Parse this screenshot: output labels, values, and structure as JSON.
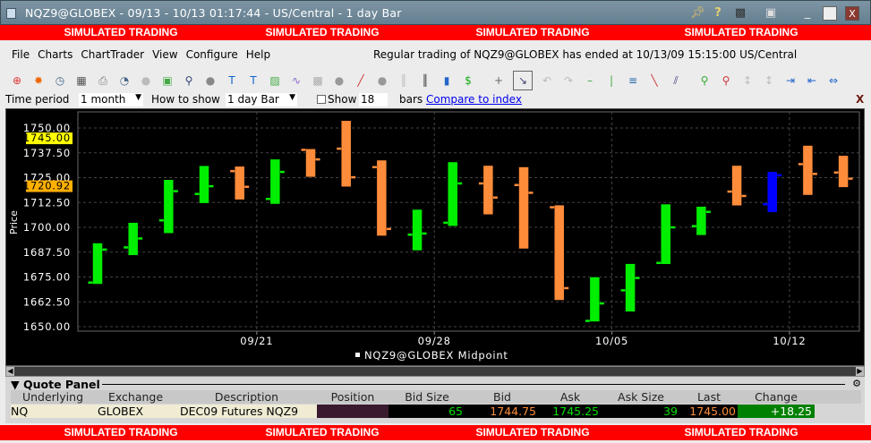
{
  "window": {
    "title": "NQZ9@GLOBEX - 09/13 - 10/13 01:17:44  - US/Central - 1 day Bar",
    "controls": [
      "pin-icon",
      "help-icon",
      "printer-icon",
      "restore-small-icon",
      "minimize-icon",
      "maximize-icon",
      "close-icon"
    ]
  },
  "banner": {
    "text": "SIMULATED TRADING",
    "color": "#ff0000"
  },
  "menu": [
    "File",
    "Charts",
    "ChartTrader",
    "View",
    "Configure",
    "Help"
  ],
  "status": "Regular trading of NQZ9@GLOBEX has ended at 10/13/09 15:15:00 US/Central",
  "toolbar": [
    "crosshair-target-icon",
    "flame-icon",
    "clock-icon",
    "grid-icon",
    "print-icon",
    "gauge-icon",
    "disabled-circle-icon",
    "layout-icon",
    "zoom-magnifier-icon",
    "stop-icon",
    "text-T-icon",
    "text-T-remove-icon",
    "chart-add-icon",
    "wave-icon",
    "grid-gray-icon",
    "circle-gray-icon",
    "pencil-icon",
    "circle-gray2-icon",
    "bars-gray-icon",
    "bars-icon",
    "volume-bars-icon",
    "dollar-icon",
    "crosshair-icon",
    "cursor-select-icon",
    "undo-icon",
    "redo-icon",
    "hline-icon",
    "vline-icon",
    "fib-icon",
    "trendline-icon",
    "channel-icon",
    "zoom-in-icon",
    "zoom-out-icon",
    "scroll-up-icon",
    "scroll-down-icon",
    "align-left-icon",
    "align-right-icon",
    "fit-icon"
  ],
  "controls": {
    "time_period_label": "Time period",
    "time_period": "1 month",
    "how_to_show_label": "How to show",
    "how_to_show": "1 day Bar",
    "show_label": "Show",
    "show_value": "18",
    "bars_label": "bars",
    "compare_link": "Compare to index"
  },
  "chart_data": {
    "type": "ohlc",
    "ylabel": "Price",
    "ylim": [
      1650,
      1750
    ],
    "yticks": [
      "1650.00",
      "1662.50",
      "1675.00",
      "1687.50",
      "1700.00",
      "1712.50",
      "1725.00",
      "1737.50",
      "1750.00"
    ],
    "markers": [
      {
        "label": "1745.00",
        "value": 1745.0,
        "color": "#ffff00"
      },
      {
        "label": "1720.92",
        "value": 1720.92,
        "color": "#ffb000"
      }
    ],
    "xticks": [
      {
        "label": "09/21",
        "index": 5
      },
      {
        "label": "09/28",
        "index": 10
      },
      {
        "label": "10/05",
        "index": 15
      },
      {
        "label": "10/12",
        "index": 20
      }
    ],
    "legend": "NQZ9@GLOBEX Midpoint",
    "colors": {
      "up": "#00ee00",
      "down": "#ff8c3a",
      "current": "#0000ff"
    },
    "bars": [
      {
        "date": "09/14",
        "o": 1672.3,
        "h": 1692.1,
        "l": 1671.4,
        "c": 1688.9,
        "dir": "up"
      },
      {
        "date": "09/15",
        "o": 1690.0,
        "h": 1702.4,
        "l": 1685.9,
        "c": 1694.5,
        "dir": "up"
      },
      {
        "date": "09/16",
        "o": 1703.6,
        "h": 1724.0,
        "l": 1697.0,
        "c": 1718.3,
        "dir": "up"
      },
      {
        "date": "09/17",
        "o": 1716.9,
        "h": 1731.0,
        "l": 1712.1,
        "c": 1720.8,
        "dir": "up"
      },
      {
        "date": "09/18",
        "o": 1728.4,
        "h": 1730.7,
        "l": 1713.9,
        "c": 1720.5,
        "dir": "down"
      },
      {
        "date": "09/21",
        "o": 1714.4,
        "h": 1734.3,
        "l": 1711.7,
        "c": 1728.0,
        "dir": "up"
      },
      {
        "date": "09/22",
        "o": 1739.1,
        "h": 1739.5,
        "l": 1725.3,
        "c": 1734.3,
        "dir": "down"
      },
      {
        "date": "09/23",
        "o": 1739.7,
        "h": 1753.7,
        "l": 1720.4,
        "c": 1725.3,
        "dir": "down"
      },
      {
        "date": "09/24",
        "o": 1730.4,
        "h": 1733.8,
        "l": 1695.7,
        "c": 1699.3,
        "dir": "down"
      },
      {
        "date": "09/25",
        "o": 1696.4,
        "h": 1709.0,
        "l": 1688.3,
        "c": 1697.0,
        "dir": "up"
      },
      {
        "date": "09/28",
        "o": 1702.4,
        "h": 1732.9,
        "l": 1700.6,
        "c": 1722.2,
        "dir": "up"
      },
      {
        "date": "09/29",
        "o": 1722.2,
        "h": 1731.1,
        "l": 1706.4,
        "c": 1715.1,
        "dir": "down"
      },
      {
        "date": "09/30",
        "o": 1721.4,
        "h": 1730.4,
        "l": 1689.2,
        "c": 1717.5,
        "dir": "down"
      },
      {
        "date": "10/01",
        "o": 1710.2,
        "h": 1711.2,
        "l": 1663.3,
        "c": 1669.5,
        "dir": "down"
      },
      {
        "date": "10/02",
        "o": 1653.0,
        "h": 1675.0,
        "l": 1652.5,
        "c": 1661.8,
        "dir": "up"
      },
      {
        "date": "10/05",
        "o": 1668.4,
        "h": 1681.7,
        "l": 1657.5,
        "c": 1674.6,
        "dir": "up"
      },
      {
        "date": "10/06",
        "o": 1682.2,
        "h": 1711.7,
        "l": 1681.4,
        "c": 1700.1,
        "dir": "up"
      },
      {
        "date": "10/07",
        "o": 1700.7,
        "h": 1710.5,
        "l": 1696.0,
        "c": 1707.9,
        "dir": "up"
      },
      {
        "date": "10/08",
        "o": 1718.1,
        "h": 1731.1,
        "l": 1710.9,
        "c": 1715.9,
        "dir": "down"
      },
      {
        "date": "10/09",
        "o": 1711.7,
        "h": 1728.0,
        "l": 1707.5,
        "c": 1726.3,
        "dir": "current"
      },
      {
        "date": "10/12",
        "o": 1731.9,
        "h": 1741.2,
        "l": 1716.2,
        "c": 1727.0,
        "dir": "down"
      },
      {
        "date": "10/13",
        "o": 1727.7,
        "h": 1736.1,
        "l": 1720.1,
        "c": 1724.6,
        "dir": "down"
      }
    ]
  },
  "quote_panel": {
    "title": "Quote Panel",
    "columns": [
      "Underlying",
      "Exchange",
      "Description",
      "Position",
      "Bid Size",
      "Bid",
      "Ask",
      "Ask Size",
      "Last",
      "Change"
    ],
    "row": {
      "underlying": "NQ",
      "exchange": "GLOBEX",
      "description": "DEC09 Futures NQZ9",
      "position": "",
      "bid_size": "65",
      "bid": "1744.75",
      "ask": "1745.25",
      "ask_size": "39",
      "last": "1745.00",
      "change": "+18.25"
    }
  }
}
